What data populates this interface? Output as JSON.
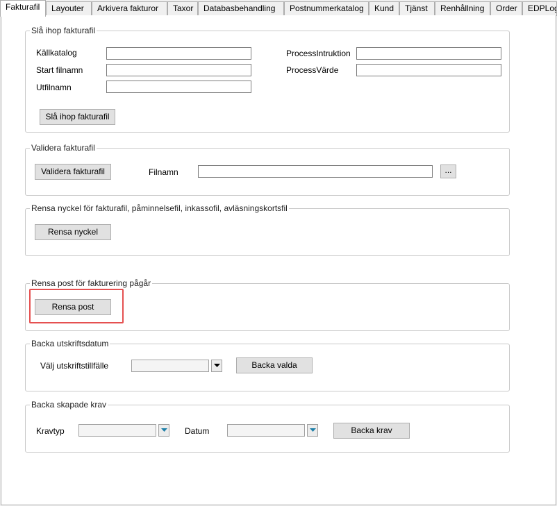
{
  "tabs": [
    "Fakturafil",
    "Layouter",
    "Arkivera fakturor",
    "Taxor",
    "Databasbehandling",
    "Postnummerkatalog",
    "Kund",
    "Tjänst",
    "Renhållning",
    "Order",
    "EDPLog"
  ],
  "merge": {
    "title": "Slå  ihop fakturafil",
    "source_dir_label": "Källkatalog",
    "start_file_label": "Start filnamn",
    "out_file_label": "Utfilnamn",
    "process_instruction_label": "ProcessIntruktion",
    "process_value_label": "ProcessVärde",
    "button": "Slå ihop fakturafil"
  },
  "validate": {
    "title": "Validera fakturafil",
    "button": "Validera fakturafil",
    "filename_label": "Filnamn",
    "browse_button": "..."
  },
  "clear_key": {
    "title": "Rensa nyckel för fakturafil, påminnelsefil, inkassofil, avläsningskortsfil",
    "button": "Rensa nyckel"
  },
  "clear_post": {
    "title": "Rensa post för fakturering pågår",
    "button": "Rensa post"
  },
  "backup_print": {
    "title": "Backa utskriftsdatum",
    "select_label": "Välj utskriftstillfälle",
    "button": "Backa valda"
  },
  "backup_claims": {
    "title": "Backa skapade krav",
    "type_label": "Kravtyp",
    "date_label": "Datum",
    "button": "Backa krav"
  },
  "colors": {
    "highlight": "#e55050",
    "dropdown_arrow": "#1e7fa8"
  }
}
